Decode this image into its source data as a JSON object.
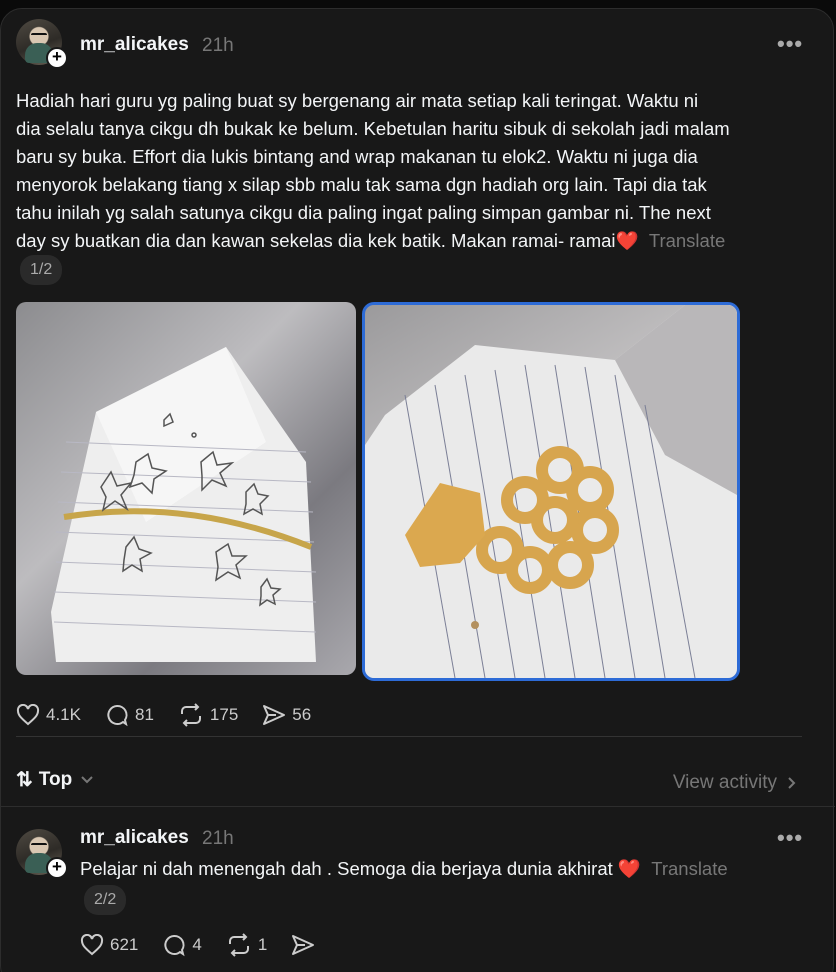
{
  "post": {
    "username": "mr_alicakes",
    "time": "21h",
    "more": "•••",
    "text_lines": [
      "Hadiah hari guru yg paling buat sy bergenang air mata setiap kali teringat. Waktu ni",
      "dia selalu tanya cikgu dh bukak ke belum. Kebetulan haritu sibuk di sekolah jadi malam",
      "baru sy buka. Effort dia lukis bintang and wrap makanan tu elok2. Waktu ni juga dia",
      "menyorok belakang tiang x silap sbb malu tak sama dgn hadiah org lain. Tapi dia tak",
      "tahu inilah yg salah satunya cikgu dia paling ingat paling simpan gambar ni. The next",
      "day sy buatkan dia dan kawan sekelas dia kek batik. Makan ramai- ramai❤️"
    ],
    "translate": "Translate",
    "thread_index": "1/2",
    "likes": "4.1K",
    "comments": "81",
    "reposts": "175",
    "shares": "56"
  },
  "sort": {
    "label": "Top",
    "view_activity": "View activity"
  },
  "reply": {
    "username": "mr_alicakes",
    "time": "21h",
    "more": "•••",
    "text": "Pelajar ni dah menengah dah . Semoga dia berjaya dunia akhirat ❤️",
    "translate": "Translate",
    "thread_index": "2/2",
    "likes": "621",
    "comments": "4",
    "reposts": "1"
  },
  "icons": [
    "heart-icon",
    "comment-icon",
    "repost-icon",
    "share-icon",
    "sort-icon",
    "chevron-down-icon",
    "chevron-right-icon",
    "more-icon",
    "follow-plus-icon"
  ]
}
